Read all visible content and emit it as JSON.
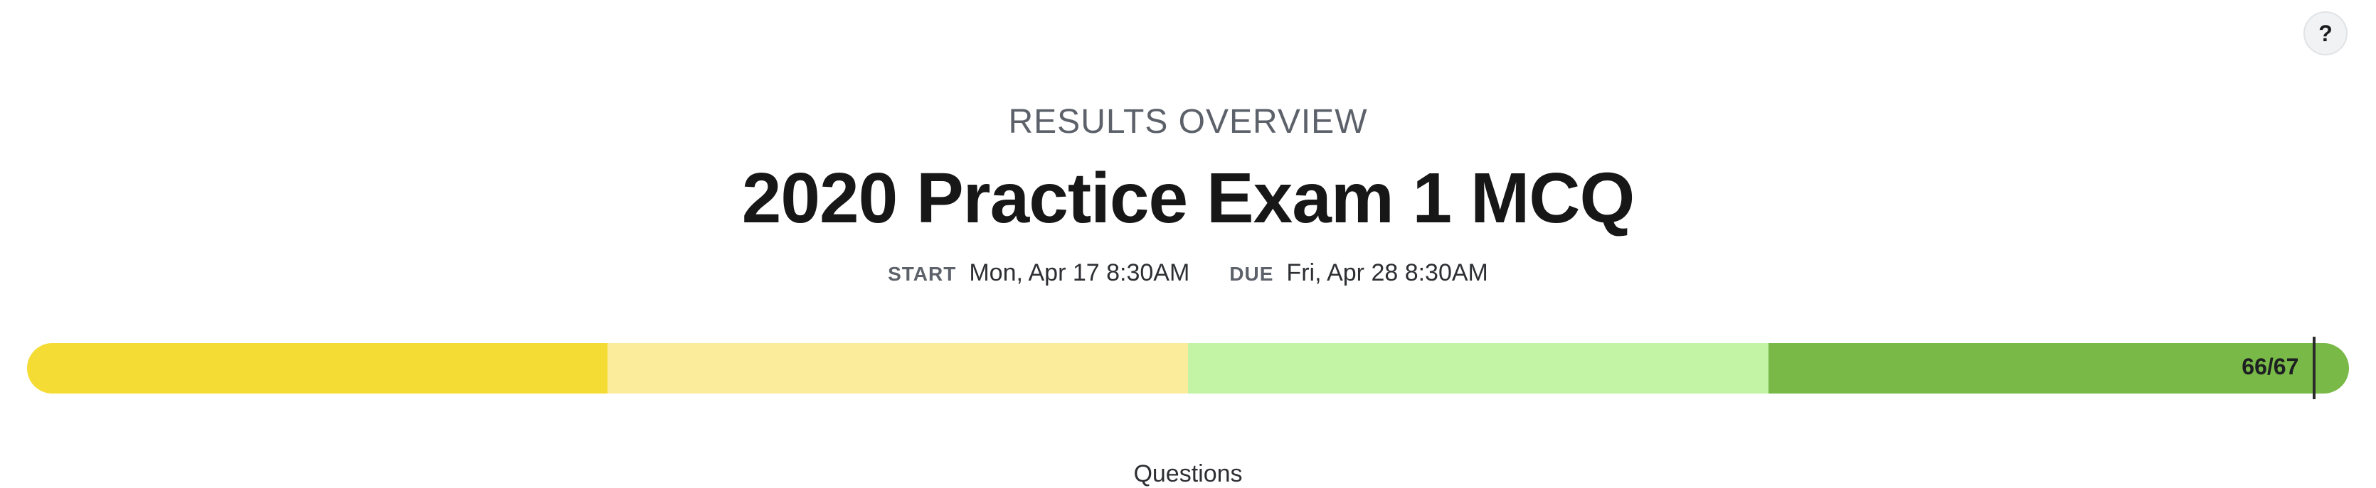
{
  "help": {
    "label": "?"
  },
  "header": {
    "eyebrow": "RESULTS OVERVIEW",
    "title": "2020 Practice Exam 1 MCQ"
  },
  "dates": {
    "start_key": "START",
    "start_value": "Mon, Apr 17 8:30AM",
    "due_key": "DUE",
    "due_value": "Fri, Apr 28 8:30AM"
  },
  "score": {
    "label": "66/67",
    "correct": 66,
    "total": 67,
    "band_colors": [
      "#f4dc34",
      "#faec9a",
      "#c3f3a4",
      "#79b947"
    ]
  },
  "section": {
    "questions_label": "Questions"
  }
}
